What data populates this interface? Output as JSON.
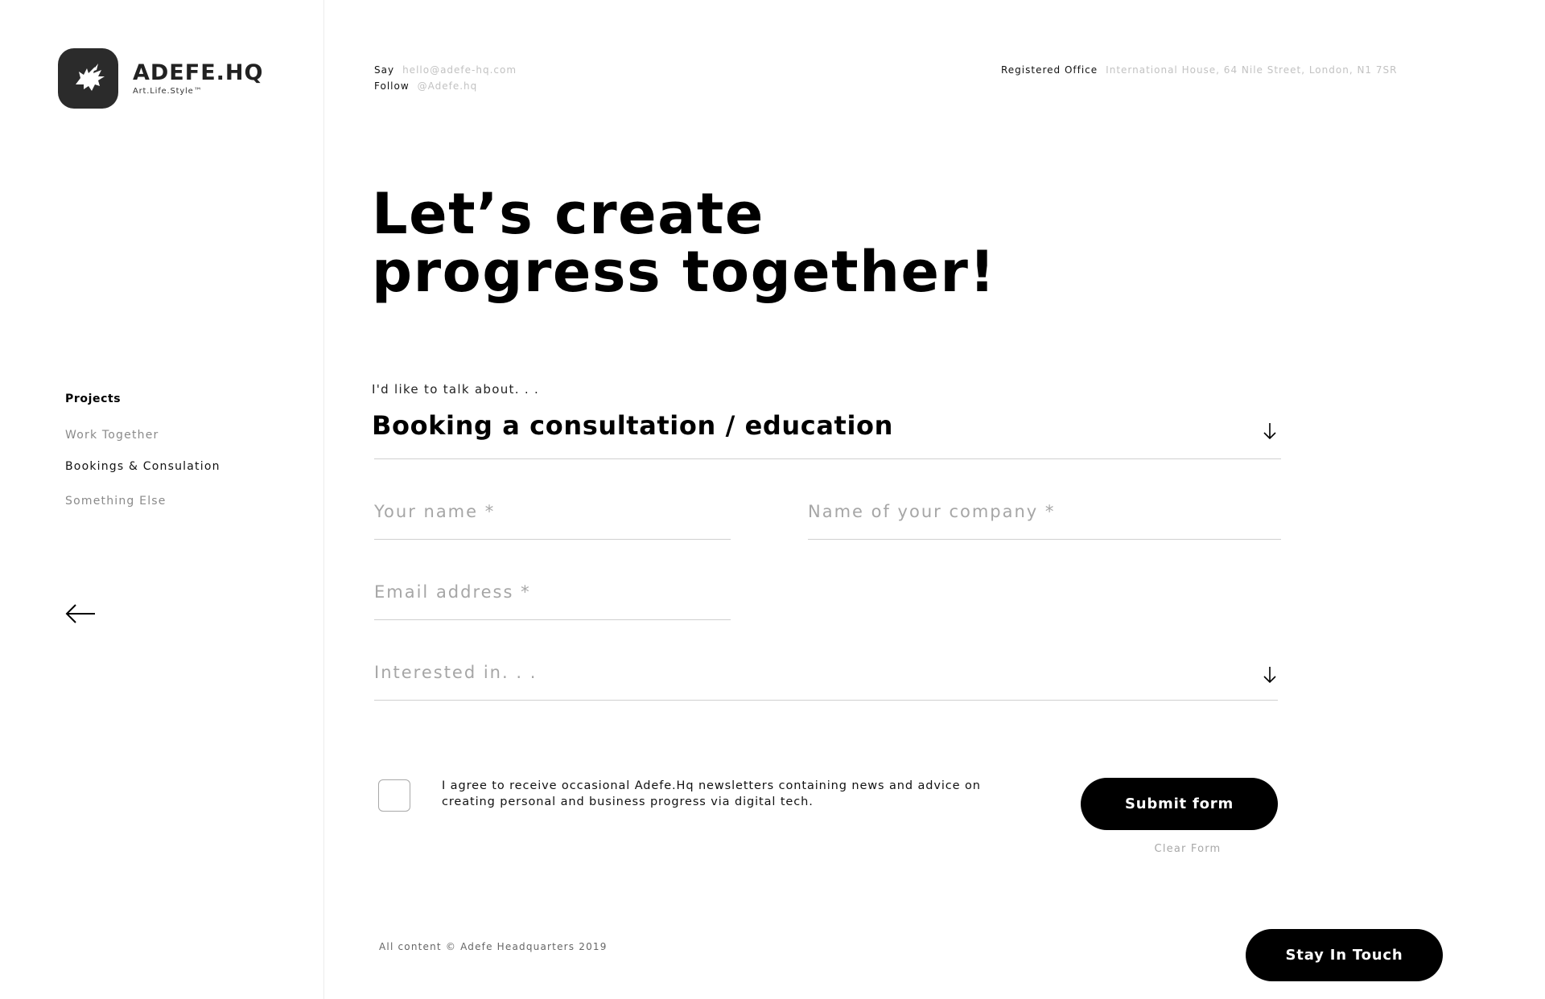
{
  "brand": {
    "name": "ADEFE.HQ",
    "tagline": "Art.Life.Style™"
  },
  "header": {
    "say_label": "Say",
    "say_value": "hello@adefe-hq.com",
    "follow_label": "Follow",
    "follow_value": "@Adefe.hq",
    "office_label": "Registered Office",
    "office_value": "International House, 64 Nile Street, London, N1 7SR"
  },
  "sidebar": {
    "title": "Projects",
    "items": [
      {
        "label": "Work Together",
        "active": false
      },
      {
        "label": "Bookings & Consulation",
        "active": true
      },
      {
        "label": "Something Else",
        "active": false
      }
    ]
  },
  "hero": {
    "line1": "Let’s create",
    "line2": "progress together!"
  },
  "form": {
    "talk_label": "I'd like to talk about. . .",
    "topic_value": "Booking a consultation / education",
    "name_placeholder": "Your name *",
    "company_placeholder": "Name of your company *",
    "email_placeholder": "Email address *",
    "interest_placeholder": "Interested in. . .",
    "consent_text": "I agree to receive occasional Adefe.Hq newsletters containing news and advice on creating personal and business progress via digital tech.",
    "consent_checked": false,
    "submit_label": "Submit form",
    "clear_label": "Clear Form"
  },
  "footer": {
    "copyright": "All content © Adefe Headquarters 2019",
    "cta_label": "Stay In Touch"
  },
  "icons": {
    "logo": "pegasus-icon",
    "back": "arrow-left-icon",
    "dropdown": "arrow-down-icon"
  }
}
